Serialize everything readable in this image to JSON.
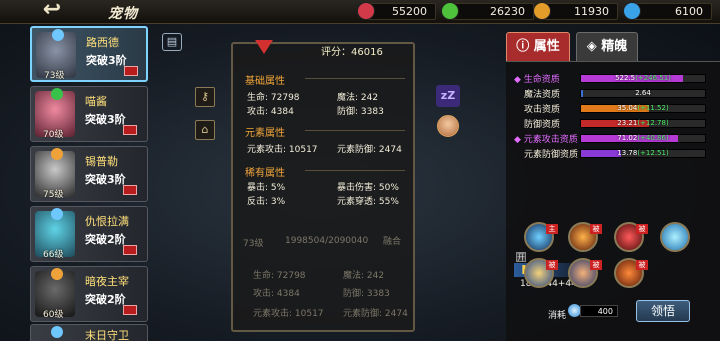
{
  "header": {
    "title": "宠物",
    "resources": [
      {
        "icon": "red-gem-icon",
        "value": "55200",
        "color": "#d23a4a"
      },
      {
        "icon": "green-gem-icon",
        "value": "26230",
        "color": "#4ec23a"
      },
      {
        "icon": "gold-coin-icon",
        "value": "11930",
        "color": "#e39b2a"
      },
      {
        "icon": "blue-crystal-icon",
        "value": "6100",
        "color": "#3aa2e6"
      }
    ]
  },
  "pets": [
    {
      "name": "路西德",
      "break": "突破3阶",
      "level": "73级",
      "element_color": "#6fc7ff",
      "selected": true
    },
    {
      "name": "喵酱",
      "break": "突破3阶",
      "level": "70级",
      "element_color": "#38c24a",
      "selected": false
    },
    {
      "name": "锡普勒",
      "break": "突破3阶",
      "level": "75级",
      "element_color": "#f0a23a",
      "selected": false
    },
    {
      "name": "仇恨拉满",
      "break": "突破2阶",
      "level": "66级",
      "element_color": "#6fc7ff",
      "selected": false
    },
    {
      "name": "暗夜主宰",
      "break": "突破2阶",
      "level": "60级",
      "element_color": "#f0a23a",
      "selected": false
    },
    {
      "name": "末日守卫",
      "break": "",
      "level": "",
      "element_color": "#6fc7ff",
      "selected": false
    }
  ],
  "center": {
    "score_label": "评分：46016",
    "basic_title": "基础属性",
    "basic": {
      "hp": "生命: 72798",
      "mp": "魔法: 242",
      "atk": "攻击: 4384",
      "def": "防御: 3383"
    },
    "element_title": "元素属性",
    "element": {
      "eatk": "元素攻击: 10517",
      "edef": "元素防御: 2474"
    },
    "rare_title": "稀有属性",
    "rare": {
      "crit": "暴击: 5%",
      "critdmg": "暴击伤害: 50%",
      "counter": "反击: 3%",
      "pierce": "元素穿透: 55%"
    },
    "ghost": {
      "level": "73级",
      "exp": "1998504/2090040",
      "fuse": "融合",
      "hp": "生命: 72798",
      "mp": "魔法: 242",
      "atk": "攻击: 4384",
      "def": "防御: 3383",
      "eatk": "元素攻击: 10517",
      "edef": "元素防御: 2474"
    }
  },
  "right": {
    "tab_attr": "属性",
    "tab_soul": "精魄",
    "aptitudes": [
      {
        "label": "生命资质",
        "value": "522.5",
        "bonus": "(+246.51)",
        "fill": 0.82,
        "color": "#b63ad6",
        "highlight": true
      },
      {
        "label": "魔法资质",
        "value": "2.64",
        "bonus": "",
        "fill": 0.02,
        "color": "#3a6fd6",
        "highlight": false
      },
      {
        "label": "攻击资质",
        "value": "35.04",
        "bonus": "(+11.52)",
        "fill": 0.55,
        "color": "#e07a1a",
        "highlight": false
      },
      {
        "label": "防御资质",
        "value": "23.21",
        "bonus": "(+12.78)",
        "fill": 0.55,
        "color": "#c42a2a",
        "highlight": false
      },
      {
        "label": "元素攻击资质",
        "value": "71.02",
        "bonus": "(+40.86)",
        "fill": 0.78,
        "color": "#b63ad6",
        "highlight": true
      },
      {
        "label": "元素防御资质",
        "value": "13.78",
        "bonus": "(+12.51)",
        "fill": 0.32,
        "color": "#8a3ad6",
        "highlight": false
      }
    ],
    "wuxing": "悟性: 188(144+44)",
    "open_label": "开",
    "skill_badges": [
      "主",
      "被",
      "被",
      "",
      "被",
      "被",
      "被"
    ],
    "cost_label": "消耗",
    "cost_value": "400",
    "learn_button": "领悟"
  }
}
